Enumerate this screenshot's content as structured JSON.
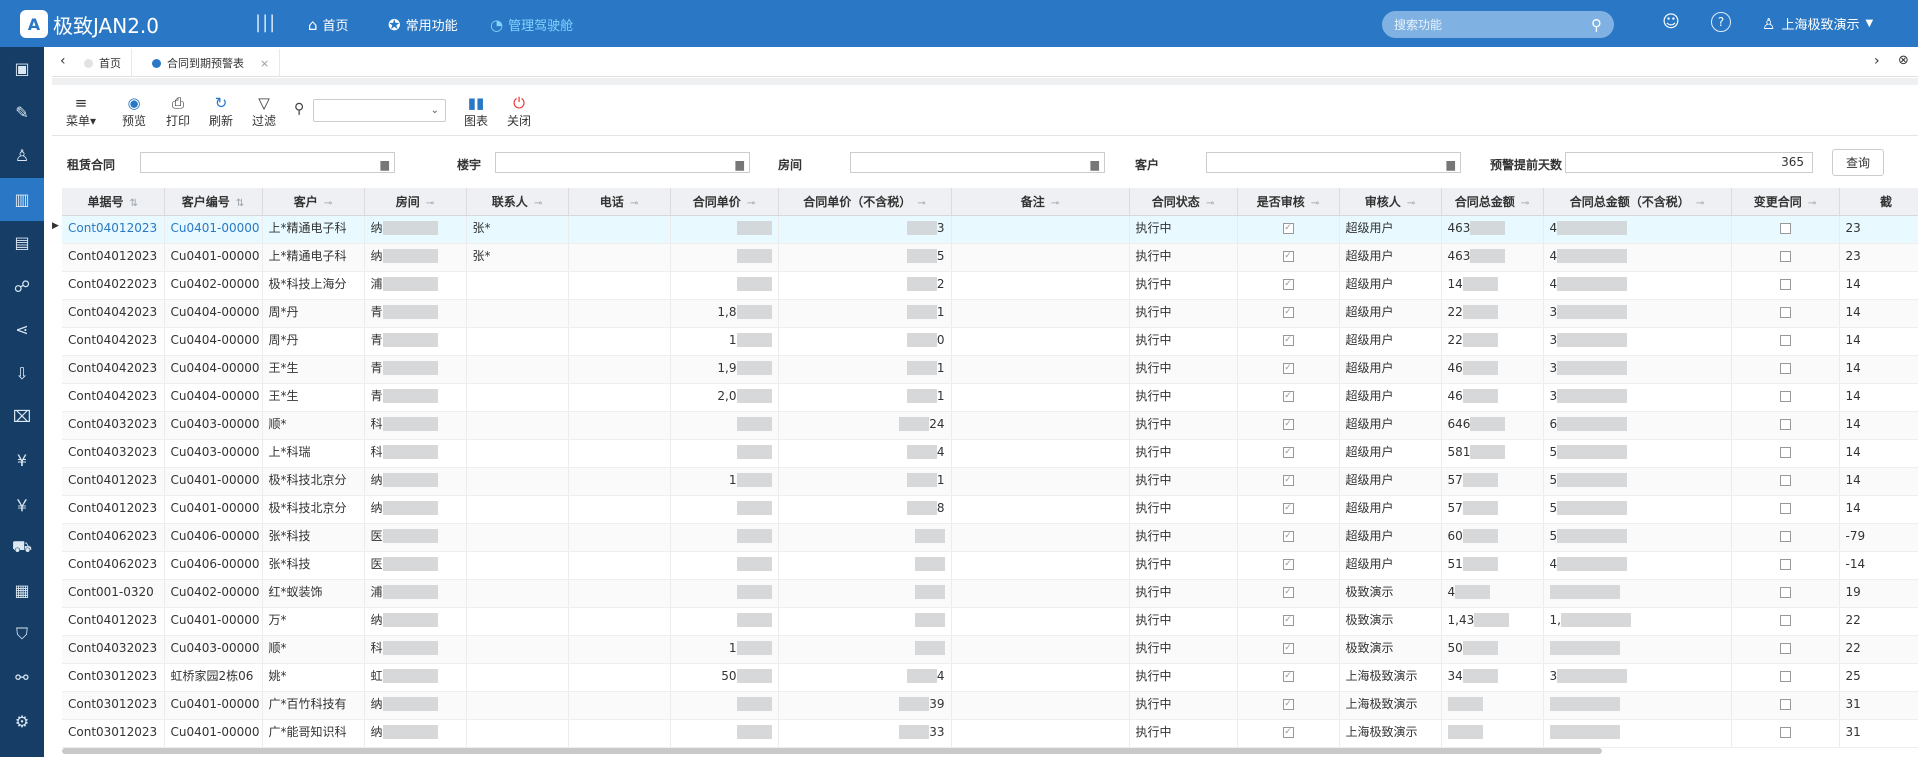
{
  "app": {
    "logo_letter": "A",
    "name": "极致JAN2.0"
  },
  "nav": [
    {
      "label": "首页",
      "icon": "home-icon"
    },
    {
      "label": "常用功能",
      "icon": "star-icon"
    },
    {
      "label": "管理驾驶舱",
      "icon": "dashboard-icon"
    }
  ],
  "search": {
    "placeholder": "搜索功能"
  },
  "user": {
    "name": "上海极致演示"
  },
  "sidebar_icons": [
    "briefcase-icon",
    "edit-icon",
    "user-icon",
    "building-icon",
    "contract-icon",
    "people-icon",
    "share-icon",
    "download-icon",
    "ticket-icon",
    "payment-icon",
    "finance-icon",
    "car-icon",
    "report-icon",
    "shield-icon",
    "link-icon",
    "settings-icon"
  ],
  "tabs": [
    {
      "label": "首页"
    },
    {
      "label": "合同到期预警表"
    }
  ],
  "toolbar": {
    "menu": "菜单",
    "preview": "预览",
    "print": "打印",
    "refresh": "刷新",
    "filter": "过滤",
    "chart": "图表",
    "close": "关闭"
  },
  "filters": {
    "lease_contract": "租赁合同",
    "building": "楼宇",
    "room": "房间",
    "customer": "客户",
    "warning_days_label": "预警提前天数",
    "warning_days_value": "365",
    "query": "查询"
  },
  "columns": [
    "单据号",
    "客户编号",
    "客户",
    "房间",
    "联系人",
    "电话",
    "合同单价",
    "合同单价（不含税）",
    "备注",
    "合同状态",
    "是否审核",
    "审核人",
    "合同总金额",
    "合同总金额（不含税）",
    "变更合同",
    "截"
  ],
  "rows": [
    {
      "no": "Cont04012023",
      "cid": "Cu0401-00000",
      "cust": "上*精通电子科",
      "room": "纳",
      "contact": "张*",
      "price": "",
      "price_nt": "3",
      "status": "执行中",
      "auditor": "超级用户",
      "total": "463",
      "total_nt": "4",
      "last": "23"
    },
    {
      "no": "Cont04012023",
      "cid": "Cu0401-00000",
      "cust": "上*精通电子科",
      "room": "纳",
      "contact": "张*",
      "price": "",
      "price_nt": "5",
      "status": "执行中",
      "auditor": "超级用户",
      "total": "463",
      "total_nt": "4",
      "last": "23"
    },
    {
      "no": "Cont04022023",
      "cid": "Cu0402-00000",
      "cust": "极*科技上海分",
      "room": "浦",
      "contact": "",
      "price": "",
      "price_nt": "2",
      "status": "执行中",
      "auditor": "超级用户",
      "total": "14",
      "total_nt": "4",
      "last": "14"
    },
    {
      "no": "Cont04042023",
      "cid": "Cu0404-00000",
      "cust": "周*丹",
      "room": "青",
      "contact": "",
      "price": "1,8",
      "price_nt": "1",
      "status": "执行中",
      "auditor": "超级用户",
      "total": "22",
      "total_nt": "3",
      "last": "14"
    },
    {
      "no": "Cont04042023",
      "cid": "Cu0404-00000",
      "cust": "周*丹",
      "room": "青",
      "contact": "",
      "price": "1",
      "price_nt": "0",
      "status": "执行中",
      "auditor": "超级用户",
      "total": "22",
      "total_nt": "3",
      "last": "14"
    },
    {
      "no": "Cont04042023",
      "cid": "Cu0404-00000",
      "cust": "王*生",
      "room": "青",
      "contact": "",
      "price": "1,9",
      "price_nt": "1",
      "status": "执行中",
      "auditor": "超级用户",
      "total": "46",
      "total_nt": "3",
      "last": "14"
    },
    {
      "no": "Cont04042023",
      "cid": "Cu0404-00000",
      "cust": "王*生",
      "room": "青",
      "contact": "",
      "price": "2,0",
      "price_nt": "1",
      "status": "执行中",
      "auditor": "超级用户",
      "total": "46",
      "total_nt": "3",
      "last": "14"
    },
    {
      "no": "Cont04032023",
      "cid": "Cu0403-00000",
      "cust": "顺*",
      "room": "科",
      "contact": "",
      "price": "",
      "price_nt": "24",
      "status": "执行中",
      "auditor": "超级用户",
      "total": "646",
      "total_nt": "6",
      "last": "14"
    },
    {
      "no": "Cont04032023",
      "cid": "Cu0403-00000",
      "cust": "上*科瑞",
      "room": "科",
      "contact": "",
      "price": "",
      "price_nt": "4",
      "status": "执行中",
      "auditor": "超级用户",
      "total": "581",
      "total_nt": "5",
      "last": "14"
    },
    {
      "no": "Cont04012023",
      "cid": "Cu0401-00000",
      "cust": "极*科技北京分",
      "room": "纳",
      "contact": "",
      "price": "1",
      "price_nt": "1",
      "status": "执行中",
      "auditor": "超级用户",
      "total": "57",
      "total_nt": "5",
      "last": "14"
    },
    {
      "no": "Cont04012023",
      "cid": "Cu0401-00000",
      "cust": "极*科技北京分",
      "room": "纳",
      "contact": "",
      "price": "",
      "price_nt": "8",
      "status": "执行中",
      "auditor": "超级用户",
      "total": "57",
      "total_nt": "5",
      "last": "14"
    },
    {
      "no": "Cont04062023",
      "cid": "Cu0406-00000",
      "cust": "张*科技",
      "room": "医",
      "contact": "",
      "price": "",
      "price_nt": "",
      "status": "执行中",
      "auditor": "超级用户",
      "total": "60",
      "total_nt": "5",
      "last": "-79"
    },
    {
      "no": "Cont04062023",
      "cid": "Cu0406-00000",
      "cust": "张*科技",
      "room": "医",
      "contact": "",
      "price": "",
      "price_nt": "",
      "status": "执行中",
      "auditor": "超级用户",
      "total": "51",
      "total_nt": "4",
      "last": "-14"
    },
    {
      "no": "Cont001-0320",
      "cid": "Cu0402-00000",
      "cust": "红*蚁装饰",
      "room": "浦",
      "contact": "",
      "price": "",
      "price_nt": "",
      "status": "执行中",
      "auditor": "极致演示",
      "total": "4",
      "total_nt": "",
      "last": "19"
    },
    {
      "no": "Cont04012023",
      "cid": "Cu0401-00000",
      "cust": "万*",
      "room": "纳",
      "contact": "",
      "price": "",
      "price_nt": "",
      "status": "执行中",
      "auditor": "极致演示",
      "total": "1,43",
      "total_nt": "1,",
      "last": "22"
    },
    {
      "no": "Cont04032023",
      "cid": "Cu0403-00000",
      "cust": "顺*",
      "room": "科",
      "contact": "",
      "price": "1",
      "price_nt": "",
      "status": "执行中",
      "auditor": "极致演示",
      "total": "50",
      "total_nt": "",
      "last": "22"
    },
    {
      "no": "Cont03012023",
      "cid": "虹桥家园2栋06",
      "cust": "姚*",
      "room": "虹",
      "contact": "",
      "price": "50",
      "price_nt": "4",
      "status": "执行中",
      "auditor": "上海极致演示",
      "total": "34",
      "total_nt": "3",
      "last": "25"
    },
    {
      "no": "Cont03012023",
      "cid": "Cu0401-00000",
      "cust": "广*百竹科技有",
      "room": "纳",
      "contact": "",
      "price": "",
      "price_nt": "39",
      "status": "执行中",
      "auditor": "上海极致演示",
      "total": "",
      "total_nt": "",
      "last": "31"
    },
    {
      "no": "Cont03012023",
      "cid": "Cu0401-00000",
      "cust": "广*能哥知识科",
      "room": "纳",
      "contact": "",
      "price": "",
      "price_nt": "33",
      "status": "执行中",
      "auditor": "上海极致演示",
      "total": "",
      "total_nt": "",
      "last": "31"
    }
  ]
}
